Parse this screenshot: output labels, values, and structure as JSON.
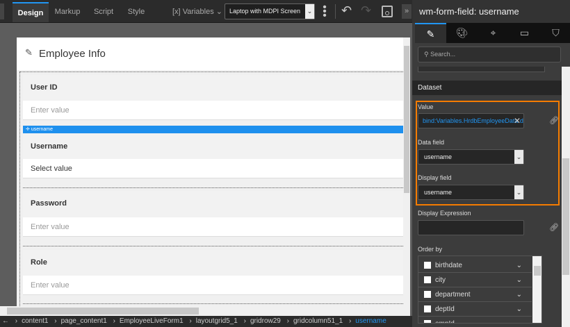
{
  "toolbar": {
    "tabs": [
      "Design",
      "Markup",
      "Script",
      "Style"
    ],
    "variables_label": "Variables",
    "variables_icon": "[x]",
    "device": "Laptop with MDPI Screen"
  },
  "form": {
    "title": "Employee Info",
    "selected_widget": "username",
    "fields": [
      {
        "label": "User ID",
        "placeholder": "Enter value"
      },
      {
        "label": "Username",
        "placeholder": "Select value"
      },
      {
        "label": "Password",
        "placeholder": "Enter value"
      },
      {
        "label": "Role",
        "placeholder": "Enter value"
      }
    ]
  },
  "breadcrumb": [
    "content1",
    "page_content1",
    "EmployeeLiveForm1",
    "layoutgrid5_1",
    "gridrow29",
    "gridcolumn51_1",
    "username"
  ],
  "panel": {
    "title": "wm-form-field: username",
    "tabs": [
      "pencil-icon",
      "palette-icon",
      "events-icon",
      "device-icon",
      "shield-icon"
    ],
    "search_placeholder": "Search...",
    "section": "Dataset",
    "value_label": "Value",
    "value": "bind:Variables.HrdbEmployeeData.data",
    "data_field_label": "Data field",
    "data_field": "username",
    "display_field_label": "Display field",
    "display_field": "username",
    "display_expression_label": "Display Expression",
    "display_expression": "",
    "order_by_label": "Order by",
    "order_by": [
      "birthdate",
      "city",
      "department",
      "deptId",
      "empId"
    ]
  },
  "colors": {
    "accent": "#2196f3",
    "highlight": "#f57c00"
  }
}
